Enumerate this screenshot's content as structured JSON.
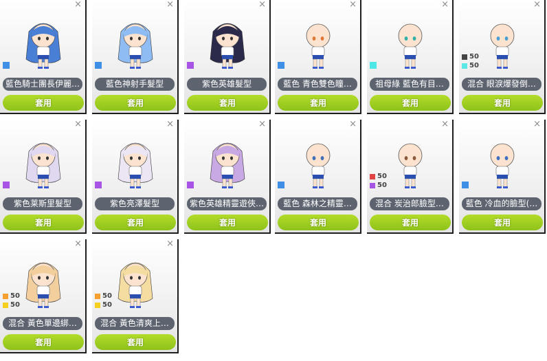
{
  "apply_label": "套用",
  "close_glyph": "×",
  "cards": [
    {
      "label": "藍色騎士團長伊麗…",
      "kind": "hair",
      "hair": "#4a7fd6",
      "swatch": "#3f8fe6"
    },
    {
      "label": "藍色神射手髮型",
      "kind": "hair",
      "hair": "#8fbcf2",
      "swatch": "#3f8fe6"
    },
    {
      "label": "紫色英雄髮型",
      "kind": "hair",
      "hair": "#2b2a4a",
      "swatch": "#a855e6"
    },
    {
      "label": "藍色 青色雙色瞳…",
      "kind": "face",
      "eyes": "#e07a3a",
      "swatch": "#3f8fe6"
    },
    {
      "label": "祖母綠 藍色有目…",
      "kind": "face",
      "eyes": "#30b0a8",
      "swatch": "#4de8e6"
    },
    {
      "label": "混合 眼淚爆發倒…",
      "kind": "face",
      "eyes": "#4aa0d0",
      "mix": [
        {
          "color": "#444444",
          "pct": "50"
        },
        {
          "color": "#5ce6e6",
          "pct": "50"
        }
      ]
    },
    {
      "label": "紫色莱斯里髮型",
      "kind": "hair",
      "hair": "#e0d8f0",
      "swatch": "#a855e6"
    },
    {
      "label": "紫色亮澤髮型",
      "kind": "hair",
      "hair": "#ece6f4",
      "swatch": "#a855e6"
    },
    {
      "label": "紫色英雄精靈遊俠…",
      "kind": "hair",
      "hair": "#c8a9e3",
      "swatch": "#a855e6"
    },
    {
      "label": "藍色 森林之精靈…",
      "kind": "face",
      "eyes": "#4070b8",
      "swatch": "#3f8fe6"
    },
    {
      "label": "混合 炭治郎臉型…",
      "kind": "face",
      "eyes": "#8a5a3a",
      "mix": [
        {
          "color": "#e04444",
          "pct": "50"
        },
        {
          "color": "#a855e6",
          "pct": "50"
        }
      ]
    },
    {
      "label": "藍色 冷血的臉型(…",
      "kind": "face",
      "eyes": "#3f6fc0",
      "swatch": "#3f8fe6"
    },
    {
      "label": "混合 黃色單邊綁…",
      "kind": "hair",
      "hair": "#f3cf9e",
      "mix": [
        {
          "color": "#f5a030",
          "pct": "50"
        },
        {
          "color": "#f5d020",
          "pct": "50"
        }
      ]
    },
    {
      "label": "混合 黃色清爽上…",
      "kind": "hair",
      "hair": "#f5dca0",
      "mix": [
        {
          "color": "#f5a030",
          "pct": "50"
        },
        {
          "color": "#f5d020",
          "pct": "50"
        }
      ]
    }
  ]
}
